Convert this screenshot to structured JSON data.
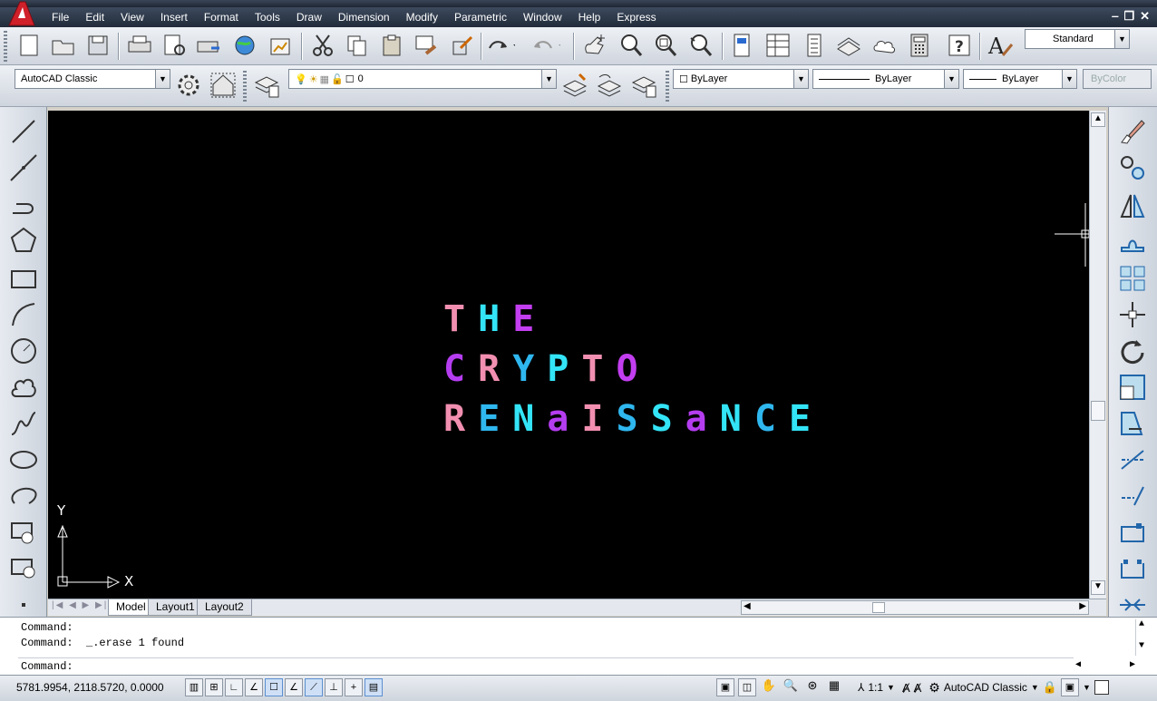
{
  "menubar": {
    "items": [
      "File",
      "Edit",
      "View",
      "Insert",
      "Format",
      "Tools",
      "Draw",
      "Dimension",
      "Modify",
      "Parametric",
      "Window",
      "Help",
      "Express"
    ]
  },
  "toolbar": {
    "text_style_value": "Standard",
    "workspace_value": "AutoCAD Classic",
    "layer_value": "0",
    "color_value": "ByLayer",
    "linetype_value": "ByLayer",
    "lineweight_value": "ByLayer",
    "plotstyle_value": "ByColor"
  },
  "canvas": {
    "background": "#000000",
    "lines": [
      {
        "id": "line1",
        "chars": [
          {
            "c": "T",
            "color": "#f28fb1"
          },
          {
            "c": "H",
            "color": "#33e4f7"
          },
          {
            "c": "E",
            "color": "#c33ef0"
          }
        ]
      },
      {
        "id": "line2",
        "chars": [
          {
            "c": "C",
            "color": "#b53df0"
          },
          {
            "c": "R",
            "color": "#f28fb1"
          },
          {
            "c": "Y",
            "color": "#2fb7ef"
          },
          {
            "c": "P",
            "color": "#33e4f7"
          },
          {
            "c": "T",
            "color": "#f28fb1"
          },
          {
            "c": "O",
            "color": "#c33ef0"
          }
        ]
      },
      {
        "id": "line3",
        "chars": [
          {
            "c": "R",
            "color": "#f28fb1"
          },
          {
            "c": "E",
            "color": "#2fb7ef"
          },
          {
            "c": "N",
            "color": "#33e4f7"
          },
          {
            "c": "a",
            "color": "#b53df0"
          },
          {
            "c": "I",
            "color": "#f28fb1"
          },
          {
            "c": "S",
            "color": "#2fb7ef"
          },
          {
            "c": "S",
            "color": "#33e4f7"
          },
          {
            "c": "a",
            "color": "#b53df0"
          },
          {
            "c": "N",
            "color": "#33e4f7"
          },
          {
            "c": "C",
            "color": "#2fb7ef"
          },
          {
            "c": "E",
            "color": "#33e4f7"
          }
        ]
      }
    ],
    "ucs_x_label": "X",
    "ucs_y_label": "Y"
  },
  "layout_tabs": [
    "Model",
    "Layout1",
    "Layout2"
  ],
  "command": {
    "history": [
      "Command:",
      "Command:  _.erase 1 found"
    ],
    "prompt": "Command:"
  },
  "status": {
    "coordinates": "5781.9954, 2118.5720, 0.0000",
    "annotation_scale": "1:1",
    "workspace": "AutoCAD Classic"
  },
  "colors": {
    "toolbar_bg": "#dbe0e7",
    "menubar_bg": "#2c3646",
    "canvas_bg": "#000000",
    "pink": "#f28fb1",
    "cyan": "#33e4f7",
    "blue": "#2fb7ef",
    "purple": "#b53df0"
  }
}
